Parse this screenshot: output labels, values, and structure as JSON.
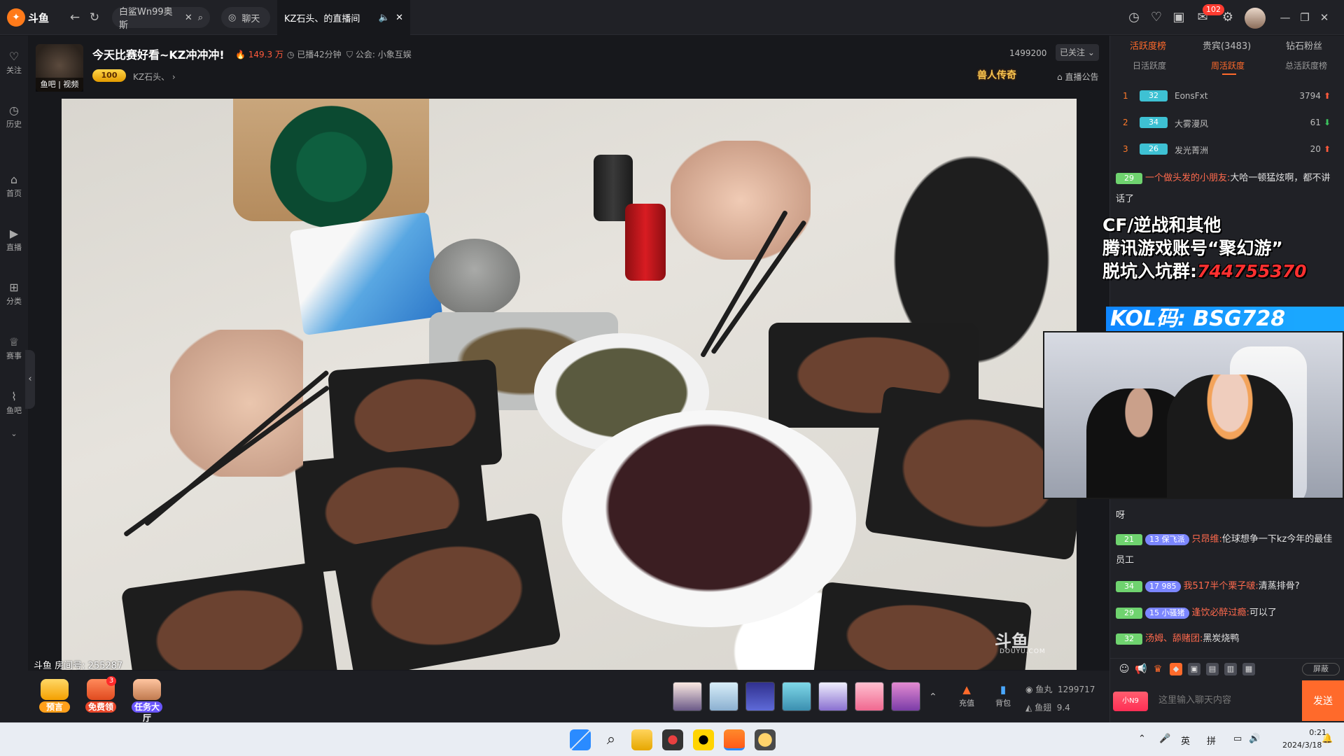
{
  "app": {
    "logo_text": "斗鱼",
    "logo_sub": "DOUYU.COM"
  },
  "tabs": {
    "search_tab": "白鲨Wn99奥斯",
    "chat_tab": "聊天",
    "live_tab": "KZ石头、的直播间"
  },
  "topbar": {
    "message_badge": "102"
  },
  "sidebar": {
    "items": [
      {
        "label": "关注"
      },
      {
        "label": "历史"
      },
      {
        "label": "首页"
      },
      {
        "label": "直播"
      },
      {
        "label": "分类"
      },
      {
        "label": "赛事"
      },
      {
        "label": "鱼吧"
      }
    ]
  },
  "room": {
    "anchor_tag": "鱼吧 | 视频",
    "title": "今天比赛好看~KZ冲冲冲!",
    "hot": "149.3 万",
    "live_time": "已播42分钟",
    "guild": "公会: 小象互娱",
    "level": "100",
    "anchor_name": "KZ石头、",
    "fans_count": "1499200",
    "follow_label": "已关注",
    "legend_badge": "兽人传奇",
    "notice_label": "直播公告",
    "room_id": "斗鱼 房间号: 255287"
  },
  "video": {
    "watermark": "斗鱼",
    "watermark_sub": "DOUYU.COM"
  },
  "bottom": {
    "actions": [
      {
        "label": "预言"
      },
      {
        "label": "免费领"
      },
      {
        "label": "任务大厅"
      }
    ],
    "action_badge": "3",
    "recharge": "充值",
    "backpack": "背包",
    "fish_ball_label": "鱼丸",
    "fish_ball_value": "1299717",
    "fish_fin_label": "鱼翅",
    "fish_fin_value": "9.4"
  },
  "ranking": {
    "tabs": [
      "活跃度榜",
      "贵宾(3483)",
      "钻石粉丝"
    ],
    "subtabs": [
      "日活跃度",
      "周活跃度",
      "总活跃度榜"
    ],
    "rows": [
      {
        "rank": "1",
        "level": "32",
        "name": "EonsFxt",
        "score": "3794",
        "trend": "up"
      },
      {
        "rank": "2",
        "level": "34",
        "name": "大雾漫风",
        "score": "61",
        "trend": "down"
      },
      {
        "rank": "3",
        "level": "26",
        "name": "发光菁洲",
        "score": "20",
        "trend": "up"
      }
    ]
  },
  "chat": {
    "messages": [
      {
        "level": "29",
        "fan": "",
        "user": "一个做头发的小朋友:",
        "text": "大哈一顿猛炫啊，都不讲话了"
      },
      {
        "level": "21",
        "fan": "13 保飞派",
        "user": "只昂维:",
        "text": "伦球想争一下kz今年的最佳员工"
      },
      {
        "level": "34",
        "fan": "17 985",
        "user": "我517半个栗子啵:",
        "text": "清蒸排骨?"
      },
      {
        "level": "29",
        "fan": "15 小骚猪",
        "user": "逢饮必醉过瘾:",
        "text": "可以了"
      },
      {
        "level": "32",
        "fan": "",
        "user": "汤姆、舔赌团:",
        "text": "黑炭烧鸭"
      }
    ],
    "partial": [
      "呀"
    ],
    "input_placeholder": "这里输入聊天内容",
    "send_label": "发送",
    "screen_toggle": "屏蔽",
    "badge_label": "小N9"
  },
  "promo": {
    "line1": "CF/逆战和其他",
    "line2": "腾讯游戏账号“聚幻游”",
    "line3_prefix": "脱坑入坑群:",
    "line3_code": "744755370",
    "kol": "KOL码: BSG728"
  },
  "taskbar": {
    "ime_en": "英",
    "ime_pin": "拼",
    "time": "0:21",
    "date": "2024/3/18"
  }
}
